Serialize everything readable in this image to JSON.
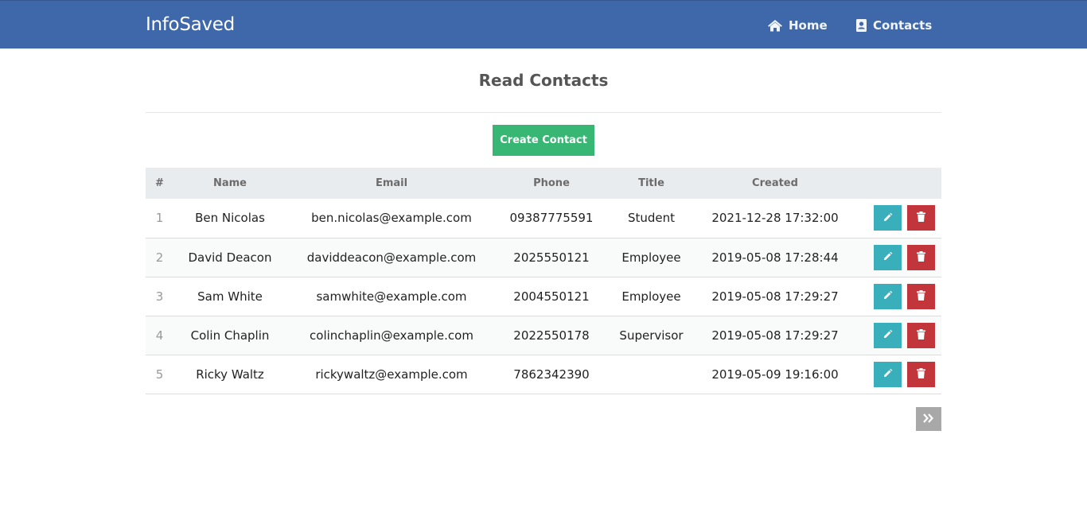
{
  "navbar": {
    "brand": "InfoSaved",
    "links": [
      {
        "label": "Home",
        "icon": "home-icon"
      },
      {
        "label": "Contacts",
        "icon": "address-book-icon"
      }
    ]
  },
  "page": {
    "title": "Read Contacts",
    "create_label": "Create Contact"
  },
  "table": {
    "columns": [
      "#",
      "Name",
      "Email",
      "Phone",
      "Title",
      "Created",
      ""
    ],
    "rows": [
      {
        "id": "1",
        "name": "Ben Nicolas",
        "email": "ben.nicolas@example.com",
        "phone": "09387775591",
        "title": "Student",
        "created": "2021-12-28 17:32:00"
      },
      {
        "id": "2",
        "name": "David Deacon",
        "email": "daviddeacon@example.com",
        "phone": "2025550121",
        "title": "Employee",
        "created": "2019-05-08 17:28:44"
      },
      {
        "id": "3",
        "name": "Sam White",
        "email": "samwhite@example.com",
        "phone": "2004550121",
        "title": "Employee",
        "created": "2019-05-08 17:29:27"
      },
      {
        "id": "4",
        "name": "Colin Chaplin",
        "email": "colinchaplin@example.com",
        "phone": "2022550178",
        "title": "Supervisor",
        "created": "2019-05-08 17:29:27"
      },
      {
        "id": "5",
        "name": "Ricky Waltz",
        "email": "rickywaltz@example.com",
        "phone": "7862342390",
        "title": "",
        "created": "2019-05-09 19:16:00"
      }
    ]
  },
  "pagination": {
    "next_icon": "double-chevron-right-icon"
  },
  "colors": {
    "navbar": "#3f68aa",
    "create_button": "#38b673",
    "edit_button": "#38afba",
    "delete_button": "#c2353b",
    "pagination_button": "#a8a8a8"
  }
}
